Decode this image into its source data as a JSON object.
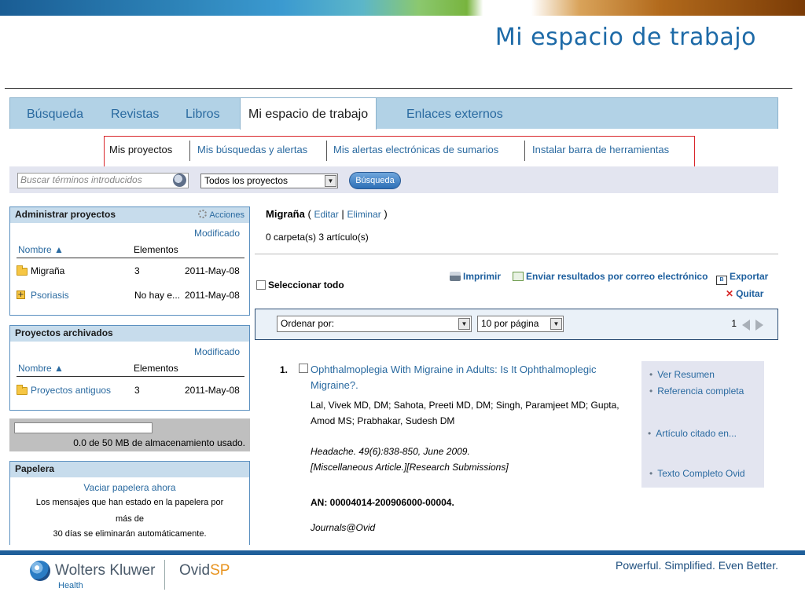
{
  "slide": {
    "title": "Mi espacio de trabajo",
    "footer": {
      "brand": "Wolters Kluwer",
      "brand_sub": "Health",
      "product_prefix": "Ovid",
      "product_suffix": "SP",
      "tagline": "Powerful. Simplified. Even Better."
    }
  },
  "tabs": [
    "Búsqueda",
    "Revistas",
    "Libros",
    "Mi espacio de trabajo",
    "Enlaces externos"
  ],
  "subnav": [
    "Mis proyectos",
    "Mis búsquedas y alertas",
    "Mis alertas electrónicas de sumarios",
    "Instalar barra de herramientas"
  ],
  "search": {
    "placeholder": "Buscar términos introducidos",
    "project_select": "Todos los proyectos",
    "button": "Búsqueda"
  },
  "manage": {
    "title": "Administrar proyectos",
    "actions": "Acciones",
    "modified": "Modificado",
    "col_name": "Nombre ▲",
    "col_items": "Elementos",
    "rows": [
      {
        "name": "Migraña",
        "items": "3",
        "date": "2011-May-08"
      },
      {
        "name": "Psoriasis",
        "items": "No hay e...",
        "date": "2011-May-08"
      }
    ]
  },
  "archived": {
    "title": "Proyectos archivados",
    "modified": "Modificado",
    "col_name": "Nombre ▲",
    "col_items": "Elementos",
    "rows": [
      {
        "name": "Proyectos antiguos",
        "items": "3",
        "date": "2011-May-08"
      }
    ]
  },
  "storage": {
    "text": "0.0 de 50 MB de almacenamiento usado.",
    "used_fraction": 0
  },
  "trash": {
    "title": "Papelera",
    "empty_link": "Vaciar papelera ahora",
    "line1": "Los mensajes que han estado en la papelera por",
    "line2": "más de",
    "line3": "30 días se eliminarán automáticamente."
  },
  "project": {
    "name": "Migraña",
    "open_paren": "(",
    "edit": "Editar",
    "sep": "|",
    "delete": "Eliminar",
    "close_paren": ")",
    "count": "0 carpeta(s) 3 artículo(s)"
  },
  "toolbar": {
    "select_all": "Seleccionar todo",
    "print": "Imprimir",
    "email": "Enviar resultados por correo electrónico",
    "export": "Exportar",
    "export_icon_text": "B",
    "remove": "Quitar"
  },
  "sorting": {
    "sort_by": "Ordenar por:",
    "per_page": "10 por página",
    "page": "1"
  },
  "result": {
    "number": "1.",
    "title": "Ophthalmoplegia With Migraine in Adults: Is It Ophthalmoplegic Migraine?.",
    "authors": "Lal, Vivek MD, DM; Sahota, Preeti MD, DM; Singh, Paramjeet MD; Gupta, Amod MS; Prabhakar, Sudesh DM",
    "source": "Headache. 49(6):838-850, June 2009.",
    "type": "[Miscellaneous Article.][Research Submissions]",
    "an": "AN: 00004014-200906000-00004.",
    "db": "Journals@Ovid",
    "links": [
      "Ver Resumen",
      "Referencia completa",
      "Artículo citado en...",
      "Texto Completo Ovid"
    ]
  }
}
